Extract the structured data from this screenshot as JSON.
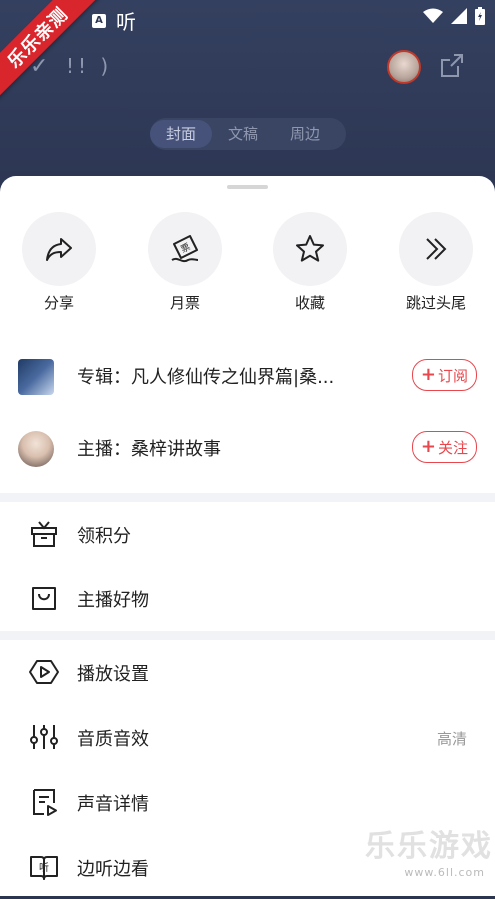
{
  "status_bar": {
    "a_badge": "A",
    "ting": "听"
  },
  "ribbon": {
    "text": "乐乐亲测"
  },
  "header": {
    "text": "!! )"
  },
  "tabs": [
    {
      "label": "封面",
      "active": true
    },
    {
      "label": "文稿",
      "active": false
    },
    {
      "label": "周边",
      "active": false
    }
  ],
  "actions": [
    {
      "label": "分享",
      "icon": "share-arrow-icon"
    },
    {
      "label": "月票",
      "icon": "monthly-ticket-icon"
    },
    {
      "label": "收藏",
      "icon": "star-icon"
    },
    {
      "label": "跳过头尾",
      "icon": "skip-double-chevron-icon"
    }
  ],
  "album": {
    "text": "专辑：凡人修仙传之仙界篇|桑...",
    "button": "订阅",
    "button_plus": "+"
  },
  "host": {
    "text": "主播：桑梓讲故事",
    "button": "关注",
    "button_plus": "+"
  },
  "menu_group_1": [
    {
      "label": "领积分",
      "icon": "gift-icon"
    },
    {
      "label": "主播好物",
      "icon": "shopping-bag-icon"
    }
  ],
  "menu_group_2": [
    {
      "label": "播放设置",
      "icon": "play-settings-icon",
      "value": ""
    },
    {
      "label": "音质音效",
      "icon": "equalizer-icon",
      "value": "高清"
    },
    {
      "label": "声音详情",
      "icon": "document-play-icon",
      "value": ""
    },
    {
      "label": "边听边看",
      "icon": "listen-read-icon",
      "value": ""
    }
  ],
  "watermark": {
    "main": "乐乐游戏",
    "sub": "www.6ll.com"
  },
  "colors": {
    "accent": "#e8474d",
    "header_bg": "#2c3653",
    "divider": "#f1f3f6"
  }
}
